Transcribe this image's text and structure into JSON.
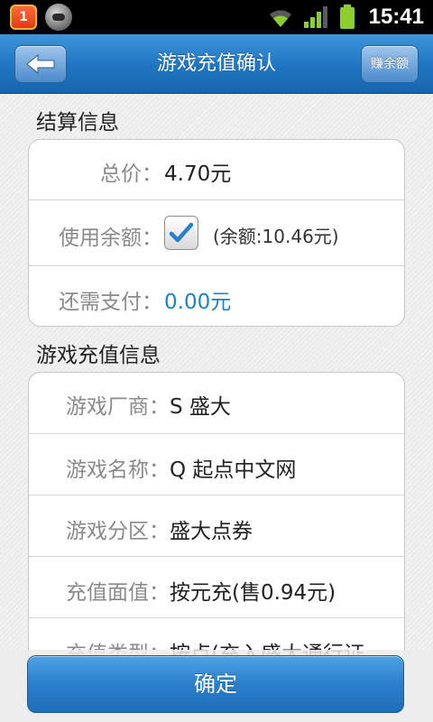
{
  "status_bar": {
    "notification_count": "1",
    "time": "15:41",
    "icons": [
      "notification-badge-icon",
      "app-icon",
      "wifi-icon",
      "signal-icon",
      "battery-icon"
    ]
  },
  "header": {
    "title": "游戏充值确认",
    "right_button": "赚余额",
    "back_icon": "back-arrow-icon"
  },
  "settlement": {
    "section_title": "结算信息",
    "total_label": "总价：",
    "total_value": "4.70元",
    "use_balance_label": "使用余额：",
    "use_balance_checked": true,
    "balance_note": "(余额:10.46元)",
    "remaining_label": "还需支付：",
    "remaining_value": "0.00元"
  },
  "recharge": {
    "section_title": "游戏充值信息",
    "rows": [
      {
        "label": "游戏厂商：",
        "value": "S 盛大"
      },
      {
        "label": "游戏名称：",
        "value": "Q 起点中文网"
      },
      {
        "label": "游戏分区：",
        "value": "盛大点券"
      },
      {
        "label": "充值面值：",
        "value": "按元充(售0.94元)"
      },
      {
        "label": "充值类型：",
        "value": "按点(充入盛大通行证"
      }
    ]
  },
  "footer": {
    "confirm_label": "确定"
  },
  "colors": {
    "accent_blue": "#1e82c8",
    "header_blue": "#2177c3"
  }
}
